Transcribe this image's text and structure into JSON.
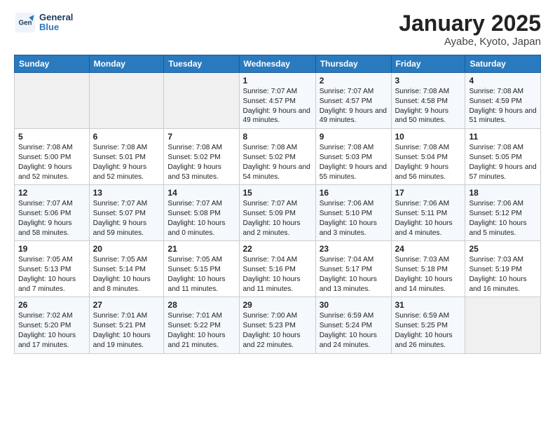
{
  "header": {
    "logo_line1": "General",
    "logo_line2": "Blue",
    "title": "January 2025",
    "subtitle": "Ayabe, Kyoto, Japan"
  },
  "weekdays": [
    "Sunday",
    "Monday",
    "Tuesday",
    "Wednesday",
    "Thursday",
    "Friday",
    "Saturday"
  ],
  "weeks": [
    [
      {
        "day": "",
        "info": ""
      },
      {
        "day": "",
        "info": ""
      },
      {
        "day": "",
        "info": ""
      },
      {
        "day": "1",
        "info": "Sunrise: 7:07 AM\nSunset: 4:57 PM\nDaylight: 9 hours and 49 minutes."
      },
      {
        "day": "2",
        "info": "Sunrise: 7:07 AM\nSunset: 4:57 PM\nDaylight: 9 hours and 49 minutes."
      },
      {
        "day": "3",
        "info": "Sunrise: 7:08 AM\nSunset: 4:58 PM\nDaylight: 9 hours and 50 minutes."
      },
      {
        "day": "4",
        "info": "Sunrise: 7:08 AM\nSunset: 4:59 PM\nDaylight: 9 hours and 51 minutes."
      }
    ],
    [
      {
        "day": "5",
        "info": "Sunrise: 7:08 AM\nSunset: 5:00 PM\nDaylight: 9 hours and 52 minutes."
      },
      {
        "day": "6",
        "info": "Sunrise: 7:08 AM\nSunset: 5:01 PM\nDaylight: 9 hours and 52 minutes."
      },
      {
        "day": "7",
        "info": "Sunrise: 7:08 AM\nSunset: 5:02 PM\nDaylight: 9 hours and 53 minutes."
      },
      {
        "day": "8",
        "info": "Sunrise: 7:08 AM\nSunset: 5:02 PM\nDaylight: 9 hours and 54 minutes."
      },
      {
        "day": "9",
        "info": "Sunrise: 7:08 AM\nSunset: 5:03 PM\nDaylight: 9 hours and 55 minutes."
      },
      {
        "day": "10",
        "info": "Sunrise: 7:08 AM\nSunset: 5:04 PM\nDaylight: 9 hours and 56 minutes."
      },
      {
        "day": "11",
        "info": "Sunrise: 7:08 AM\nSunset: 5:05 PM\nDaylight: 9 hours and 57 minutes."
      }
    ],
    [
      {
        "day": "12",
        "info": "Sunrise: 7:07 AM\nSunset: 5:06 PM\nDaylight: 9 hours and 58 minutes."
      },
      {
        "day": "13",
        "info": "Sunrise: 7:07 AM\nSunset: 5:07 PM\nDaylight: 9 hours and 59 minutes."
      },
      {
        "day": "14",
        "info": "Sunrise: 7:07 AM\nSunset: 5:08 PM\nDaylight: 10 hours and 0 minutes."
      },
      {
        "day": "15",
        "info": "Sunrise: 7:07 AM\nSunset: 5:09 PM\nDaylight: 10 hours and 2 minutes."
      },
      {
        "day": "16",
        "info": "Sunrise: 7:06 AM\nSunset: 5:10 PM\nDaylight: 10 hours and 3 minutes."
      },
      {
        "day": "17",
        "info": "Sunrise: 7:06 AM\nSunset: 5:11 PM\nDaylight: 10 hours and 4 minutes."
      },
      {
        "day": "18",
        "info": "Sunrise: 7:06 AM\nSunset: 5:12 PM\nDaylight: 10 hours and 5 minutes."
      }
    ],
    [
      {
        "day": "19",
        "info": "Sunrise: 7:05 AM\nSunset: 5:13 PM\nDaylight: 10 hours and 7 minutes."
      },
      {
        "day": "20",
        "info": "Sunrise: 7:05 AM\nSunset: 5:14 PM\nDaylight: 10 hours and 8 minutes."
      },
      {
        "day": "21",
        "info": "Sunrise: 7:05 AM\nSunset: 5:15 PM\nDaylight: 10 hours and 11 minutes."
      },
      {
        "day": "22",
        "info": "Sunrise: 7:04 AM\nSunset: 5:16 PM\nDaylight: 10 hours and 11 minutes."
      },
      {
        "day": "23",
        "info": "Sunrise: 7:04 AM\nSunset: 5:17 PM\nDaylight: 10 hours and 13 minutes."
      },
      {
        "day": "24",
        "info": "Sunrise: 7:03 AM\nSunset: 5:18 PM\nDaylight: 10 hours and 14 minutes."
      },
      {
        "day": "25",
        "info": "Sunrise: 7:03 AM\nSunset: 5:19 PM\nDaylight: 10 hours and 16 minutes."
      }
    ],
    [
      {
        "day": "26",
        "info": "Sunrise: 7:02 AM\nSunset: 5:20 PM\nDaylight: 10 hours and 17 minutes."
      },
      {
        "day": "27",
        "info": "Sunrise: 7:01 AM\nSunset: 5:21 PM\nDaylight: 10 hours and 19 minutes."
      },
      {
        "day": "28",
        "info": "Sunrise: 7:01 AM\nSunset: 5:22 PM\nDaylight: 10 hours and 21 minutes."
      },
      {
        "day": "29",
        "info": "Sunrise: 7:00 AM\nSunset: 5:23 PM\nDaylight: 10 hours and 22 minutes."
      },
      {
        "day": "30",
        "info": "Sunrise: 6:59 AM\nSunset: 5:24 PM\nDaylight: 10 hours and 24 minutes."
      },
      {
        "day": "31",
        "info": "Sunrise: 6:59 AM\nSunset: 5:25 PM\nDaylight: 10 hours and 26 minutes."
      },
      {
        "day": "",
        "info": ""
      }
    ]
  ]
}
